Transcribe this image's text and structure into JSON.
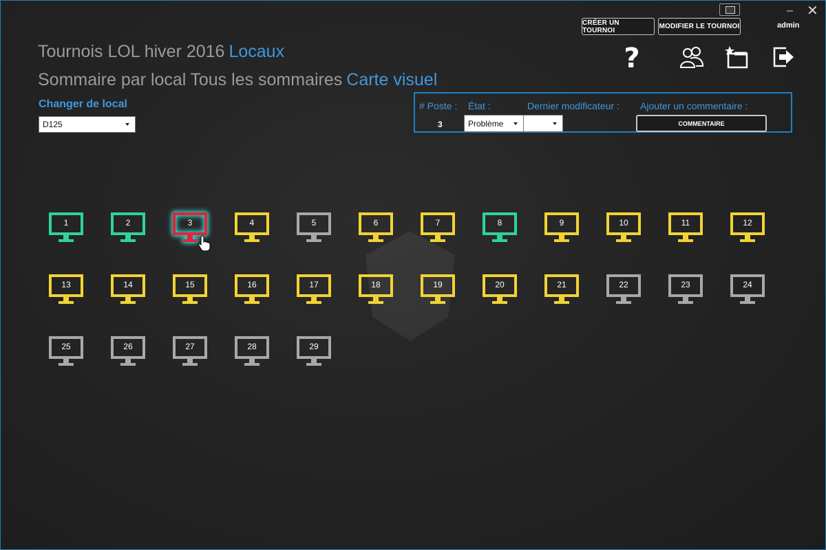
{
  "titlebar": {
    "minimize": "–",
    "close": "✕"
  },
  "header": {
    "create_button": "CRÉER UN TOURNOI",
    "modify_button": "MODIFIER LE TOURNOI",
    "user": "admin",
    "tournament_title": "Tournois LOL hiver 2016",
    "nav_locaux": "Locaux",
    "nav_sommaire_local": "Sommaire par local",
    "nav_tous_sommaires": "Tous les sommaires",
    "nav_carte_visuel": "Carte visuel",
    "help_glyph": "?"
  },
  "icons": [
    "help-icon",
    "users-icon",
    "new-window-icon",
    "exit-icon"
  ],
  "local": {
    "label": "Changer de local",
    "selected": "D125"
  },
  "panel": {
    "poste_label": "# Poste :",
    "etat_label": "État :",
    "modificateur_label": "Dernier modificateur :",
    "commentaire_label": "Ajouter un commentaire :",
    "poste_value": "3",
    "etat_value": "Problème",
    "modificateur_value": "",
    "commentaire_button": "COMMENTAIRE"
  },
  "colors": {
    "accent": "#3f98de",
    "ok": "#2fd39a",
    "problem": "#e0243b",
    "busy": "#f2d335",
    "inactive": "#a8a8a8"
  },
  "stations": [
    {
      "number": "1",
      "status": "ok"
    },
    {
      "number": "2",
      "status": "ok"
    },
    {
      "number": "3",
      "status": "problem",
      "selected": true
    },
    {
      "number": "4",
      "status": "busy"
    },
    {
      "number": "5",
      "status": "inactive"
    },
    {
      "number": "6",
      "status": "busy"
    },
    {
      "number": "7",
      "status": "busy"
    },
    {
      "number": "8",
      "status": "ok"
    },
    {
      "number": "9",
      "status": "busy"
    },
    {
      "number": "10",
      "status": "busy"
    },
    {
      "number": "11",
      "status": "busy"
    },
    {
      "number": "12",
      "status": "busy"
    },
    {
      "number": "13",
      "status": "busy"
    },
    {
      "number": "14",
      "status": "busy"
    },
    {
      "number": "15",
      "status": "busy"
    },
    {
      "number": "16",
      "status": "busy"
    },
    {
      "number": "17",
      "status": "busy"
    },
    {
      "number": "18",
      "status": "busy"
    },
    {
      "number": "19",
      "status": "busy"
    },
    {
      "number": "20",
      "status": "busy"
    },
    {
      "number": "21",
      "status": "busy"
    },
    {
      "number": "22",
      "status": "inactive"
    },
    {
      "number": "23",
      "status": "inactive"
    },
    {
      "number": "24",
      "status": "inactive"
    },
    {
      "number": "25",
      "status": "inactive"
    },
    {
      "number": "26",
      "status": "inactive"
    },
    {
      "number": "27",
      "status": "inactive"
    },
    {
      "number": "28",
      "status": "inactive"
    },
    {
      "number": "29",
      "status": "inactive"
    }
  ]
}
